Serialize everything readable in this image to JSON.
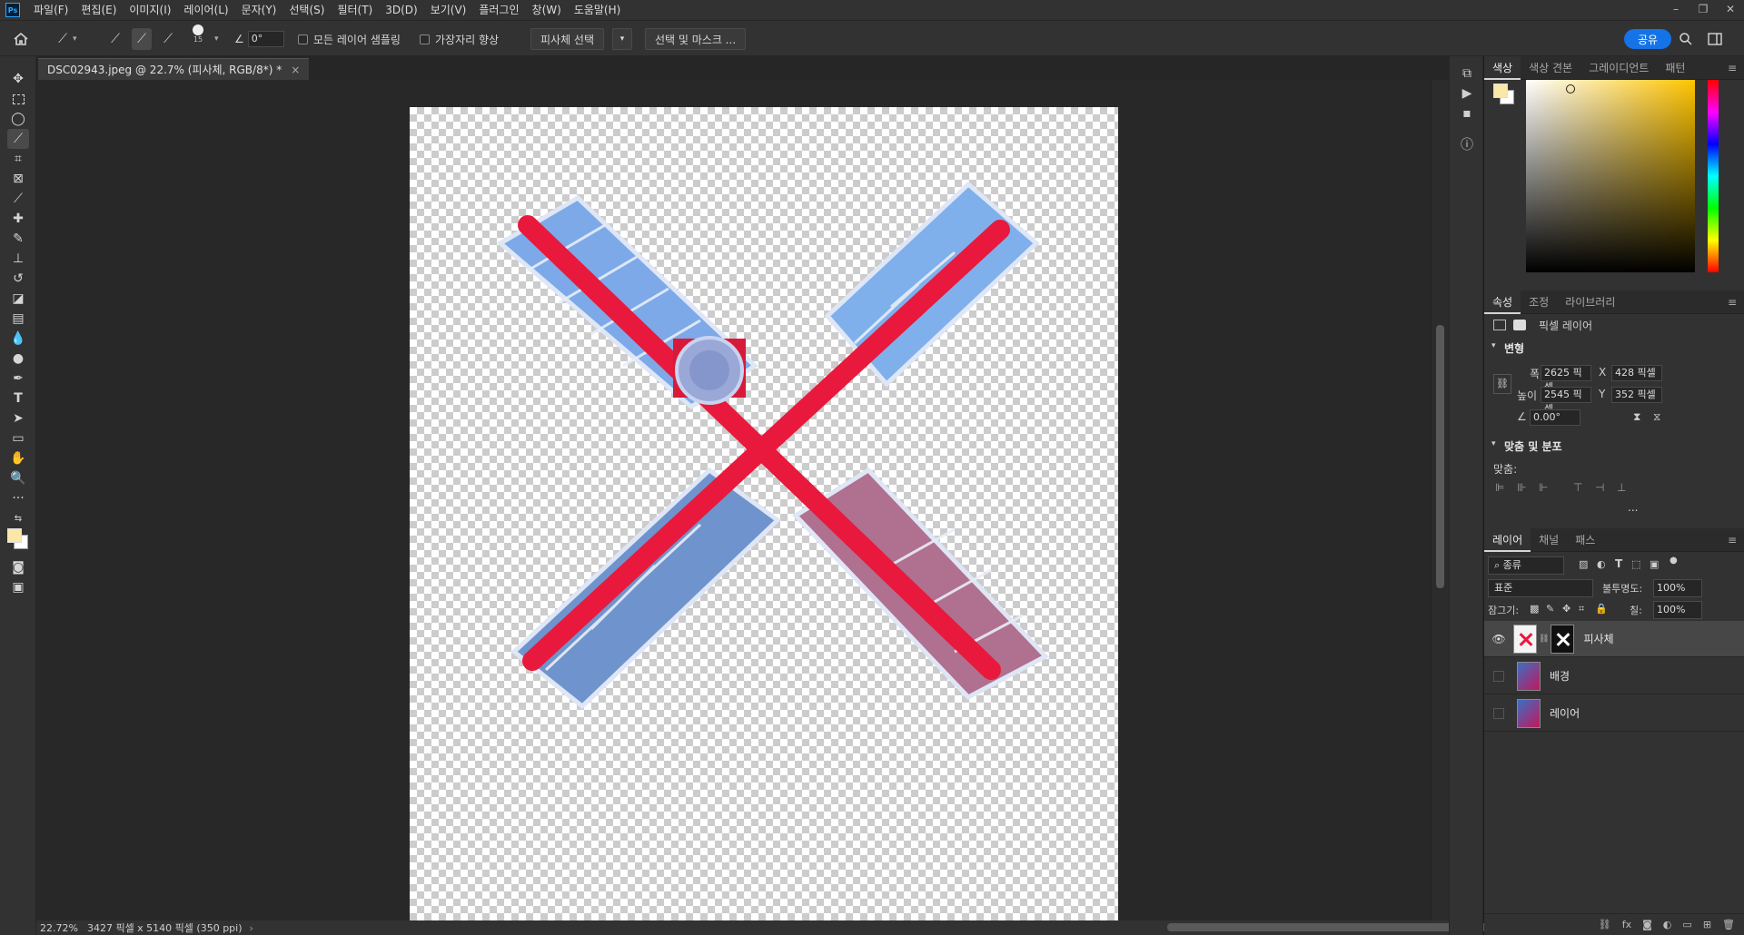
{
  "app": {
    "logo": "Ps",
    "accent": "#31a8ff"
  },
  "menu": [
    "파일(F)",
    "편집(E)",
    "이미지(I)",
    "레이어(L)",
    "문자(Y)",
    "선택(S)",
    "필터(T)",
    "3D(D)",
    "보기(V)",
    "플러그인",
    "창(W)",
    "도움말(H)"
  ],
  "window_controls": {
    "minimize": "–",
    "restore": "❐",
    "close": "✕"
  },
  "options": {
    "brush_size": "15",
    "angle": "0°",
    "sample_all_layers": "모든 레이어 샘플링",
    "enhance_edge": "가장자리 향상",
    "select_subject": "피사체 선택",
    "select_and_mask": "선택 및 마스크 ...",
    "share": "공유"
  },
  "document_tab": {
    "title": "DSC02943.jpeg @ 22.7% (피사체, RGB/8*) *",
    "close": "×"
  },
  "status": {
    "zoom": "22.72%",
    "info": "3427 픽셀 x 5140 픽셀 (350 ppi)"
  },
  "color_panel": {
    "tabs": [
      "색상",
      "색상 견본",
      "그레이디언트",
      "패턴"
    ],
    "foreground": "#fbe7a8",
    "background": "#ffffff"
  },
  "properties_panel": {
    "tabs": [
      "속성",
      "조정",
      "라이브러리"
    ],
    "layer_type": "픽셀 레이어",
    "transform_title": "변형",
    "width_label": "폭",
    "width": "2625 픽셀",
    "height_label": "높이",
    "height": "2545 픽셀",
    "x_label": "X",
    "x": "428 픽셀",
    "y_label": "Y",
    "y": "352 픽셀",
    "angle": "0.00°",
    "align_title": "맞춤 및 분포",
    "align_label": "맞춤:",
    "more": "..."
  },
  "layers_panel": {
    "tabs": [
      "레이어",
      "채널",
      "패스"
    ],
    "filter_kind": "종류",
    "blend_mode": "표준",
    "opacity_label": "불투명도:",
    "opacity": "100%",
    "lock_label": "잠그기:",
    "fill_label": "칠:",
    "fill": "100%",
    "layers": [
      {
        "name": "피사체",
        "visible": true
      },
      {
        "name": "배경",
        "visible": false
      },
      {
        "name": "레이어",
        "visible": false
      }
    ],
    "footer_icons": [
      "link-icon",
      "fx-icon",
      "mask-icon",
      "adjustment-icon",
      "group-icon",
      "new-layer-icon",
      "delete-icon"
    ]
  }
}
